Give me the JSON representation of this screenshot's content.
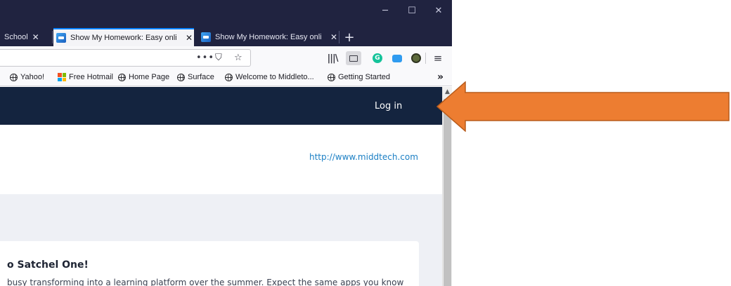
{
  "window": {
    "minimize": "─",
    "maximize": "☐",
    "close": "✕"
  },
  "tabs": [
    {
      "title": "School",
      "close": "✕"
    },
    {
      "title": "Show My Homework: Easy onli",
      "close": "✕"
    },
    {
      "title": "Show My Homework: Easy onli",
      "close": "✕"
    }
  ],
  "new_tab": "+",
  "toolbar": {
    "page_actions": "•••",
    "pocket": "⛉",
    "bookmark": "☆",
    "library": "|||\\",
    "grammarly": "G",
    "menu": "≡"
  },
  "bookmarks": {
    "items": [
      "Yahoo!",
      "Free Hotmail",
      "Home Page",
      "Surface",
      "Welcome to Middleto...",
      "Getting Started"
    ],
    "overflow": "»"
  },
  "page": {
    "login": "Log in",
    "school_url": "http://www.middtech.com",
    "welcome_title": "o Satchel One!",
    "welcome_body": "busy transforming into a learning platform over the summer. Expect the same apps you know"
  },
  "scrollbar": {
    "up": "▲"
  },
  "colors": {
    "tabstrip": "#202340",
    "site_header": "#14243f",
    "link": "#1b7fc4",
    "arrow_fill": "#ed7d31",
    "arrow_stroke": "#b85c1c"
  }
}
